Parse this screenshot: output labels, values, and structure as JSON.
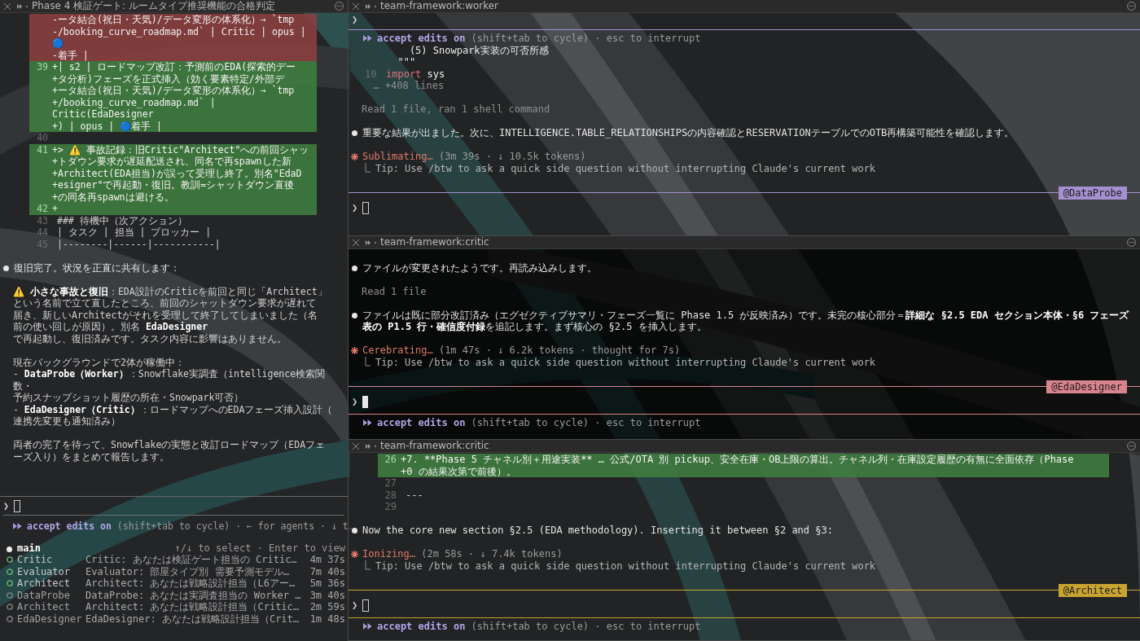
{
  "left_pane": {
    "title": "Phase 4 検証ゲート: ルームタイプ推奨機能の合格判定",
    "focused": false,
    "lines": [
      {
        "kind": "removed",
        "text": "-ータ結合(祝日・天気)/データ変形の体系化）→ `tmp"
      },
      {
        "kind": "removed",
        "text": "-/booking_curve_roadmap.md` | Critic | opus | 🔵"
      },
      {
        "kind": "removed",
        "text": "-着手 |"
      },
      {
        "kind": "added",
        "number": "39",
        "text": "+| s2 | ロードマップ改訂：予測前のEDA(探索的デー"
      },
      {
        "kind": "added",
        "text": "+タ分析)フェーズを正式挿入（効く要素特定/外部デ"
      },
      {
        "kind": "added",
        "text": "+ータ結合(祝日・天気)/データ変形の体系化）→ `tmp"
      },
      {
        "kind": "added",
        "text": "+/booking_curve_roadmap.md` | Critic(EdaDesigner"
      },
      {
        "kind": "added",
        "text": "+) | opus | 🔵着手 |"
      },
      {
        "kind": "context",
        "number": "40"
      },
      {
        "kind": "added",
        "number": "41",
        "text": "+> ⚠️ 事故記録：旧Critic\"Architect\"への前回シャッ"
      },
      {
        "kind": "added",
        "text": "+トダウン要求が遅延配送され、同名で再spawnした新"
      },
      {
        "kind": "added",
        "text": "+Architect(EDA担当)が誤って受理し終了。別名\"EdaD"
      },
      {
        "kind": "added",
        "text": "+esigner\"で再起動・復旧。教訓=シャットダウン直後"
      },
      {
        "kind": "added",
        "text": "+の同名再spawnは避ける。"
      },
      {
        "kind": "added",
        "number": "42",
        "text": "+"
      },
      {
        "kind": "context",
        "number": "43",
        "text": "### 待機中（次アクション）"
      },
      {
        "kind": "context",
        "number": "44",
        "text": "| タスク | 担当 | ブロッカー |"
      },
      {
        "kind": "context",
        "number": "45",
        "text": "|--------|------|-----------|"
      },
      {
        "kind": "blank"
      },
      {
        "kind": "bullet",
        "text": "復旧完了。状況を正直に共有します："
      },
      {
        "kind": "blank"
      },
      {
        "kind": "text",
        "text": "⚠️ **小さな事故と復旧**：EDA設計のCriticを前回と同じ「Architect」"
      },
      {
        "kind": "text",
        "text": "という名前で立て直したところ、前回のシャットダウン要求が遅れて"
      },
      {
        "kind": "text",
        "text": "届き、新しいArchitectがそれを受理して終了してしまいました（名"
      },
      {
        "kind": "text",
        "text": "前の使い回しが原因）。別名 **EdaDesigner**"
      },
      {
        "kind": "text",
        "text": "で再起動し、復旧済みです。タスク内容に影響はありません。"
      },
      {
        "kind": "blank"
      },
      {
        "kind": "text",
        "text": "現在バックグラウンドで2体が稼働中："
      },
      {
        "kind": "text",
        "text": "- **DataProbe（Worker）**：Snowflake実調査（intelligence検索関数・"
      },
      {
        "kind": "text",
        "text": "予約スナップショット履歴の所在・Snowpark可否）"
      },
      {
        "kind": "text",
        "text": "- **EdaDesigner（Critic）**：ロードマップへのEDAフェーズ挿入設計（"
      },
      {
        "kind": "text",
        "text": "連携先変更も通知済み）"
      },
      {
        "kind": "blank"
      },
      {
        "kind": "text",
        "text": "両者の完了を待って、Snowflakeの実態と改訂ロードマップ（EDAフェ"
      },
      {
        "kind": "text",
        "text": "ーズ入り）をまとめて報告します。"
      }
    ],
    "prompt": "❯",
    "mode": {
      "label": "accept edits on",
      "hint": "(shift+tab to cycle) · ← for agents · ↓ t…"
    },
    "agents": {
      "main": "main",
      "hint": "↑/↓ to select · Enter to view",
      "items": [
        {
          "name": "Critic",
          "description": "Critic: あなたは検証ゲート担当の Critic…",
          "elapsed": "4m 37s",
          "running": true
        },
        {
          "name": "Evaluator",
          "description": "Evaluator: 部屋タイプ別 需要予測モデル…",
          "elapsed": "7m 40s",
          "running": true
        },
        {
          "name": "Architect",
          "description": "Architect: あなたは戦略設計担当（L6アー…",
          "elapsed": "5m 36s",
          "running": true
        },
        {
          "name": "DataProbe",
          "description": "DataProbe: あなたは実調査担当の Worker …",
          "elapsed": "3m 40s",
          "running": false
        },
        {
          "name": "Architect",
          "description": "Architect: あなたは戦略設計担当（Critic…",
          "elapsed": "2m 59s",
          "running": false
        },
        {
          "name": "EdaDesigner",
          "description": "EdaDesigner: あなたは戦略設計担当（Crit…",
          "elapsed": "1m 48s",
          "running": false
        }
      ]
    }
  },
  "panes": [
    {
      "title": "team-framework:worker",
      "color": "#a48fd0",
      "focused": false,
      "lines": [
        {
          "kind": "echo",
          "text": "❯"
        },
        {
          "kind": "rule"
        },
        {
          "kind": "mode",
          "label": "accept edits on",
          "hint": "(shift+tab to cycle) · esc to interrupt"
        },
        {
          "kind": "code",
          "text": "    (5) Snowpark実装の可否所感"
        },
        {
          "kind": "code",
          "text": "  \"\"\""
        },
        {
          "kind": "code",
          "number": "10",
          "keyword": "import",
          "text": "sys"
        },
        {
          "kind": "muted",
          "text": "  … +408 lines"
        },
        {
          "kind": "blank"
        },
        {
          "kind": "muted",
          "text": "Read 1 file, ran 1 shell command"
        },
        {
          "kind": "blank"
        },
        {
          "kind": "bullet",
          "text": "重要な結果が出ました。次に、INTELLIGENCE.TABLE_RELATIONSHIPSの内容確認とRESERVATIONテーブルでのOTB再構築可能性を確認します。"
        },
        {
          "kind": "blank"
        },
        {
          "kind": "spinner",
          "verb": "Sublimating…",
          "detail": "(3m 39s · ↓ 10.5k tokens)"
        },
        {
          "kind": "tip",
          "text": "Tip: Use /btw to ask a quick side question without interrupting Claude's current work"
        },
        {
          "kind": "blank"
        },
        {
          "kind": "badge_rule",
          "badge": "@DataProbe"
        },
        {
          "kind": "prompt",
          "text": "❯"
        }
      ]
    },
    {
      "title": "team-framework:critic",
      "color": "#d9848c",
      "focused": true,
      "lines": [
        {
          "kind": "blank"
        },
        {
          "kind": "bullet",
          "text": "ファイルが変更されたようです。再読み込みします。"
        },
        {
          "kind": "blank"
        },
        {
          "kind": "muted",
          "text": "Read 1 file"
        },
        {
          "kind": "blank"
        },
        {
          "kind": "bullet",
          "text": "ファイルは既に部分改訂済み（エグゼクティブサマリ・フェーズ一覧に Phase 1.5 が反映済み）です。未完の核心部分＝**詳細な §2.5 EDA セクション本体・§6 フェーズ表の P1.5 行・確信度付録**を追記します。まず核心の §2.5 を挿入します。"
        },
        {
          "kind": "blank"
        },
        {
          "kind": "spinner",
          "verb": "Cerebrating…",
          "detail": "(1m 47s · ↓ 6.2k tokens · thought for 7s)"
        },
        {
          "kind": "tip",
          "text": "Tip: Use /btw to ask a quick side question without interrupting Claude's current work"
        },
        {
          "kind": "blank"
        },
        {
          "kind": "badge_rule",
          "badge": "@EdaDesigner"
        },
        {
          "kind": "prompt",
          "text": "❯"
        },
        {
          "kind": "rule"
        },
        {
          "kind": "mode",
          "label": "accept edits on",
          "hint": "(shift+tab to cycle) · esc to interrupt"
        }
      ]
    },
    {
      "title": "team-framework:critic",
      "color": "#c9a431",
      "focused": false,
      "lines": [
        {
          "kind": "added",
          "number": "26",
          "text": "+7. **Phase 5 チャネル別＋用途実装** … 公式/OTA 別 pickup、安全在庫・OB上限の算出。チャネル列・在庫設定履歴の有無に全面依存（Phase"
        },
        {
          "kind": "added",
          "text": "+0 の結果次第で前後）。"
        },
        {
          "kind": "context",
          "number": "27"
        },
        {
          "kind": "context",
          "number": "28",
          "text": "---"
        },
        {
          "kind": "context",
          "number": "29"
        },
        {
          "kind": "blank"
        },
        {
          "kind": "bullet",
          "text": "Now the core new section §2.5 (EDA methodology). Inserting it between §2 and §3:"
        },
        {
          "kind": "blank"
        },
        {
          "kind": "spinner",
          "verb": "Ionizing…",
          "detail": "(2m 58s · ↓ 7.4k tokens)"
        },
        {
          "kind": "tip",
          "text": "Tip: Use /btw to ask a quick side question without interrupting Claude's current work"
        },
        {
          "kind": "blank"
        },
        {
          "kind": "badge_rule",
          "badge": "@Architect"
        },
        {
          "kind": "prompt",
          "text": "❯"
        },
        {
          "kind": "rule"
        },
        {
          "kind": "mode",
          "label": "accept edits on",
          "hint": "(shift+tab to cycle) · esc to interrupt"
        }
      ]
    }
  ]
}
